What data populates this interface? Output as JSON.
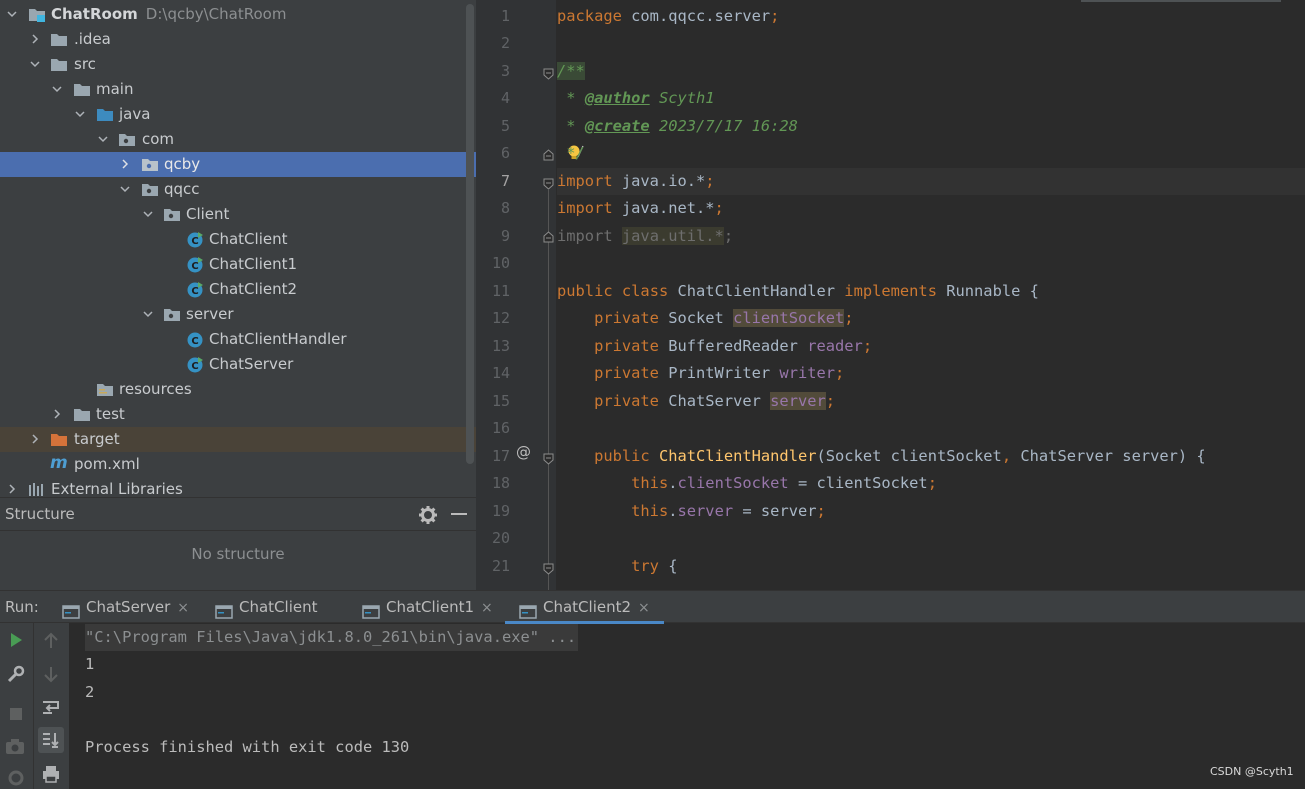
{
  "project": {
    "root": {
      "label": "ChatRoom",
      "path": "D:\\qcby\\ChatRoom"
    },
    "items": [
      {
        "label": ".idea"
      },
      {
        "label": "src"
      },
      {
        "label": "main"
      },
      {
        "label": "java"
      },
      {
        "label": "com"
      },
      {
        "label": "qcby"
      },
      {
        "label": "qqcc"
      },
      {
        "label": "Client"
      },
      {
        "label": "ChatClient"
      },
      {
        "label": "ChatClient1"
      },
      {
        "label": "ChatClient2"
      },
      {
        "label": "server"
      },
      {
        "label": "ChatClientHandler"
      },
      {
        "label": "ChatServer"
      },
      {
        "label": "resources"
      },
      {
        "label": "test"
      },
      {
        "label": "target"
      },
      {
        "label": "pom.xml"
      },
      {
        "label": "External Libraries"
      }
    ],
    "pom_glyph": "m"
  },
  "structure": {
    "title": "Structure",
    "empty_text": "No structure"
  },
  "editor": {
    "line_numbers": [
      "1",
      "2",
      "3",
      "4",
      "5",
      "6",
      "7",
      "8",
      "9",
      "10",
      "11",
      "12",
      "13",
      "14",
      "15",
      "16",
      "17",
      "18",
      "19",
      "20",
      "21"
    ],
    "current_line": "7",
    "override_marker": "@",
    "lines": {
      "l1_kw": "package",
      "l1_rest": " com.qqcc.server",
      "l1_semi": ";",
      "l3": "/**",
      "l4_star": " * ",
      "l4_tag": "@author",
      "l4_val": " Scyth1",
      "l5_star": " * ",
      "l5_tag": "@create",
      "l5_val": " 2023/7/17 16:28",
      "l6": " */",
      "l7_kw": "import",
      "l7_rest": " java.io.*",
      "l7_semi": ";",
      "l8_kw": "import",
      "l8_rest": " java.net.*",
      "l8_semi": ";",
      "l9_kw": "import",
      "l9_sp": " ",
      "l9_rest": "java.util.*",
      "l9_semi": ";",
      "l11_kw1": "public",
      "l11_kw2": "class",
      "l11_name": " ChatClientHandler ",
      "l11_kw3": "implements",
      "l11_rest": " Runnable {",
      "l12_kw": "private",
      "l12_type": " Socket ",
      "l12_fld": "clientSocket",
      "l12_semi": ";",
      "l13_kw": "private",
      "l13_type": " BufferedReader ",
      "l13_fld": "reader",
      "l13_semi": ";",
      "l14_kw": "private",
      "l14_type": " PrintWriter ",
      "l14_fld": "writer",
      "l14_semi": ";",
      "l15_kw": "private",
      "l15_type": " ChatServer ",
      "l15_fld": "server",
      "l15_semi": ";",
      "l17_kw": "public",
      "l17_fn": "ChatClientHandler",
      "l17_p1": "(Socket clientSocket",
      "l17_c": ",",
      "l17_p2": " ChatServer server) {",
      "l18_kw": "this",
      "l18_dot": ".",
      "l18_fld": "clientSocket",
      "l18_rest": " = clientSocket",
      "l18_semi": ";",
      "l19_kw": "this",
      "l19_dot": ".",
      "l19_fld": "server",
      "l19_rest": " = server",
      "l19_semi": ";",
      "l21_kw": "try",
      "l21_rest": " {"
    }
  },
  "run": {
    "label": "Run:",
    "tabs": [
      "ChatServer",
      "ChatClient",
      "ChatClient1",
      "ChatClient2"
    ],
    "active_tab": "ChatClient2",
    "close_glyph": "×",
    "output": [
      "\"C:\\Program Files\\Java\\jdk1.8.0_261\\bin\\java.exe\" ...",
      "1",
      "2",
      "",
      "Process finished with exit code 130"
    ]
  },
  "watermark": "CSDN @Scyth1",
  "colors": {
    "keyword": "#cc7832",
    "comment": "#629755",
    "field": "#9876aa",
    "function": "#ffc66d",
    "selection": "#4b6eaf",
    "excluded": "#4a4338"
  }
}
